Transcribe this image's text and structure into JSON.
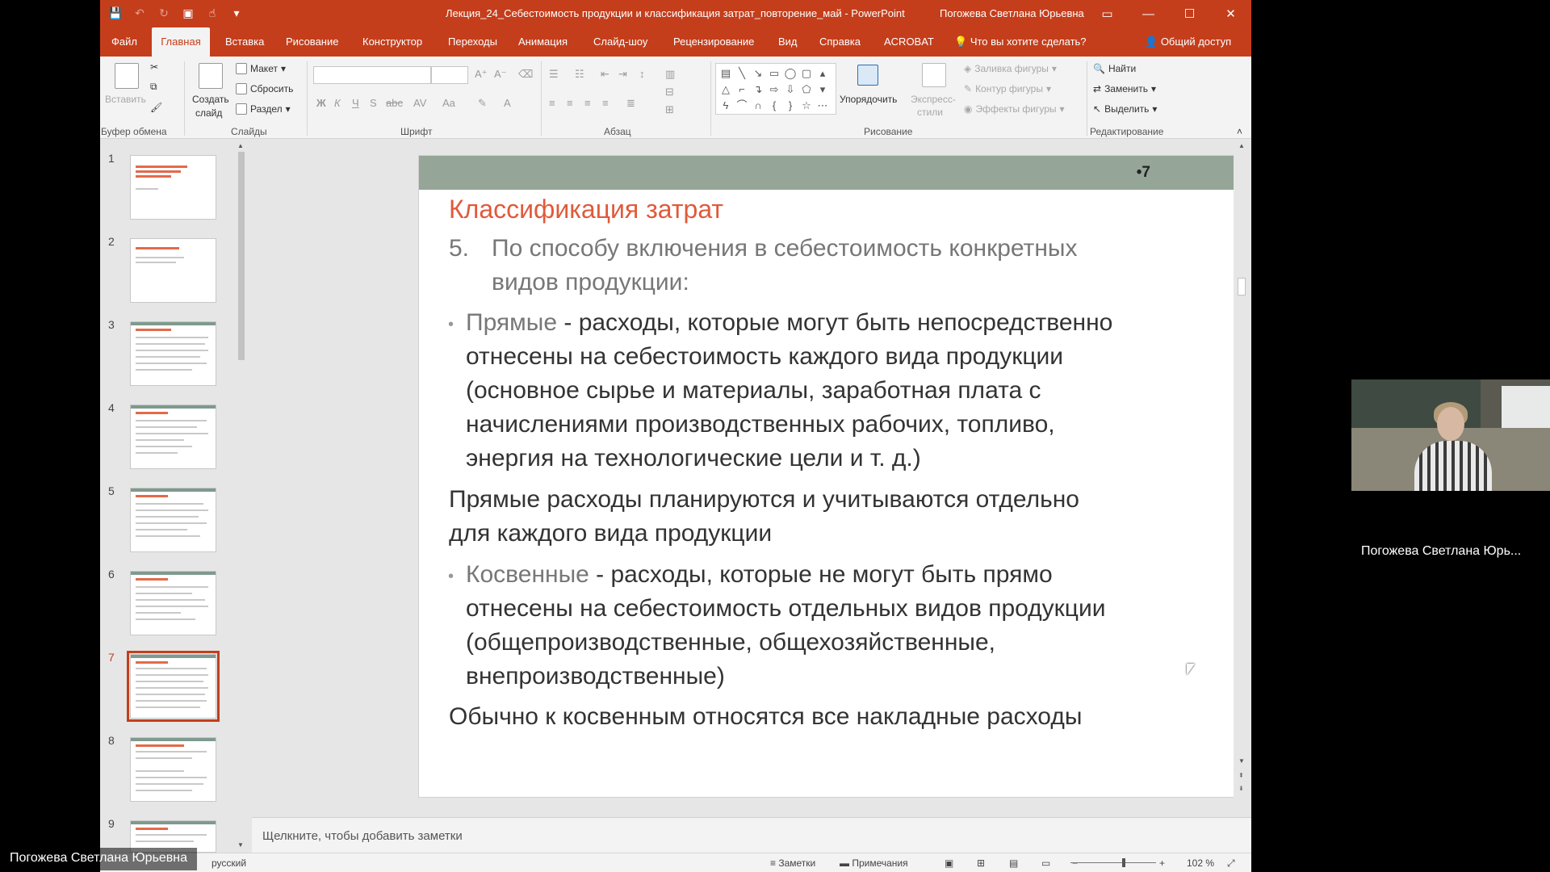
{
  "window": {
    "doc_title": "Лекция_24_Себестоимость продукции и классификация затрат_повторение_май  -  PowerPoint",
    "user_name": "Погожева Светлана Юрьевна"
  },
  "menu": {
    "file": "Файл",
    "home": "Главная",
    "insert": "Вставка",
    "draw": "Рисование",
    "design": "Конструктор",
    "transitions": "Переходы",
    "animations": "Анимация",
    "slideshow": "Слайд-шоу",
    "review": "Рецензирование",
    "view": "Вид",
    "help": "Справка",
    "acrobat": "ACROBAT",
    "tell_me": "Что вы хотите сделать?",
    "share": "Общий доступ"
  },
  "ribbon": {
    "paste": "Вставить",
    "create_slide": "Создать",
    "create_slide2": "слайд",
    "layout": "Макет",
    "reset": "Сбросить",
    "section": "Раздел",
    "arrange": "Упорядочить",
    "quick_styles": "Экспресс-",
    "quick_styles2": "стили",
    "shape_fill": "Заливка фигуры",
    "shape_outline": "Контур фигуры",
    "shape_effects": "Эффекты фигуры",
    "find": "Найти",
    "replace": "Заменить",
    "select": "Выделить",
    "groups": {
      "clipboard": "Буфер обмена",
      "slides": "Слайды",
      "font": "Шрифт",
      "paragraph": "Абзац",
      "drawing": "Рисование",
      "editing": "Редактирование"
    }
  },
  "thumbnails": [
    "1",
    "2",
    "3",
    "4",
    "5",
    "6",
    "7",
    "8",
    "9"
  ],
  "slide": {
    "number": "•7",
    "title": "Классификация затрат",
    "item_number": "5.",
    "item_line1": "По способу включения в себестоимость конкретных",
    "item_line2": "видов продукции:",
    "direct_term": "Прямые",
    "direct_l1": " - расходы, которые могут быть непосредственно",
    "direct_l2": "отнесены на себестоимость каждого вида продукции",
    "direct_l3": "(основное сырье и материалы, заработная плата с",
    "direct_l4": "начислениями производственных рабочих, топливо,",
    "direct_l5": "энергия на технологические цели и т. д.)",
    "direct_note_l1": "Прямые расходы планируются и учитываются отдельно",
    "direct_note_l2": "для каждого вида продукции",
    "indirect_term": "Косвенные",
    "indirect_l1": " -  расходы, которые не могут быть прямо",
    "indirect_l2": "отнесены на себестоимость отдельных видов продукции",
    "indirect_l3": "(общепроизводственные, общехозяйственные,",
    "indirect_l4": "внепроизводственные)",
    "indirect_note": "Обычно к косвенным относятся все накладные расходы"
  },
  "notes_placeholder": "Щелкните, чтобы добавить заметки",
  "status": {
    "language": "русский",
    "notes": "Заметки",
    "comments": "Примечания",
    "zoom": "102 %"
  },
  "video": {
    "local_name": "Погожева Светлана Юрьевна",
    "remote_name": "Погожева Светлана Юрь..."
  }
}
